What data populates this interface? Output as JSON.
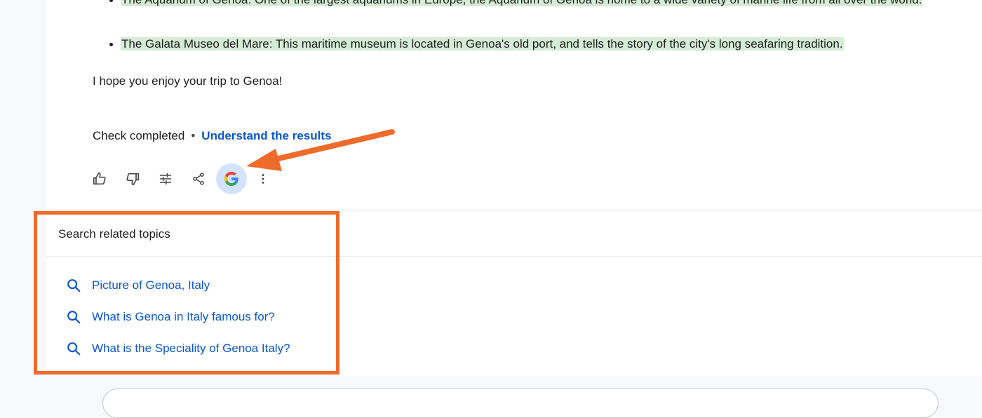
{
  "response": {
    "bullets": [
      {
        "text": "The Aquarium of Genoa: One of the largest aquariums in Europe, the Aquarium of Genoa is home to a wide variety of marine life from all over the world."
      },
      {
        "text": "The Galata Museo del Mare: This maritime museum is located in Genoa's old port, and tells the story of the city's long seafaring tradition."
      }
    ],
    "closing": "I hope you enjoy your trip to Genoa!",
    "check_status": "Check completed",
    "separator": "•",
    "understand_link": "Understand the results"
  },
  "actions": [
    {
      "name": "thumbs-up-icon"
    },
    {
      "name": "thumbs-down-icon"
    },
    {
      "name": "tune-icon"
    },
    {
      "name": "share-icon"
    },
    {
      "name": "google-g-icon",
      "active": true
    },
    {
      "name": "more-vert-icon"
    }
  ],
  "related": {
    "title": "Search related topics",
    "items": [
      {
        "label": "Picture of Genoa, Italy"
      },
      {
        "label": "What is Genoa in Italy famous for?"
      },
      {
        "label": "What is the Speciality of Genoa Italy?"
      }
    ]
  },
  "colors": {
    "accent": "#0b57d0",
    "highlight": "#d5ecd6",
    "annotation": "#ee6b29",
    "g_active_bg": "#d3e3fd"
  }
}
